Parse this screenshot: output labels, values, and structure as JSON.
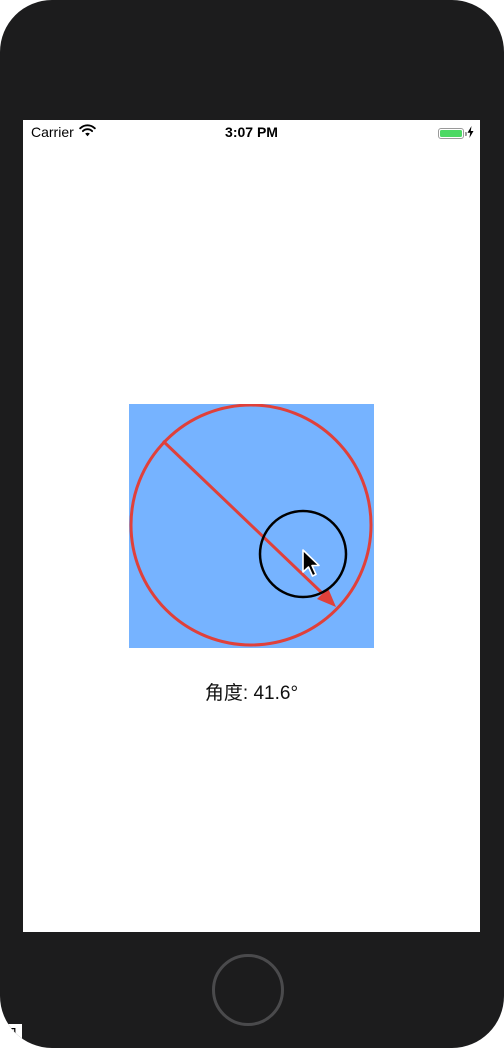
{
  "status_bar": {
    "carrier": "Carrier",
    "time": "3:07 PM",
    "icons": [
      "wifi-icon",
      "battery-icon",
      "charging-bolt-icon"
    ]
  },
  "angle_view": {
    "background_color": "#76b3ff",
    "circle_color": "#e0403a",
    "angle_degrees": 41.6
  },
  "angle_label": {
    "text": "角度: 41.6°"
  },
  "bottom_glyph": {
    "text": "知"
  },
  "colors": {
    "device_frame": "#1c1c1d",
    "battery_fill": "#4cd964",
    "arrow": "#e0403a"
  }
}
